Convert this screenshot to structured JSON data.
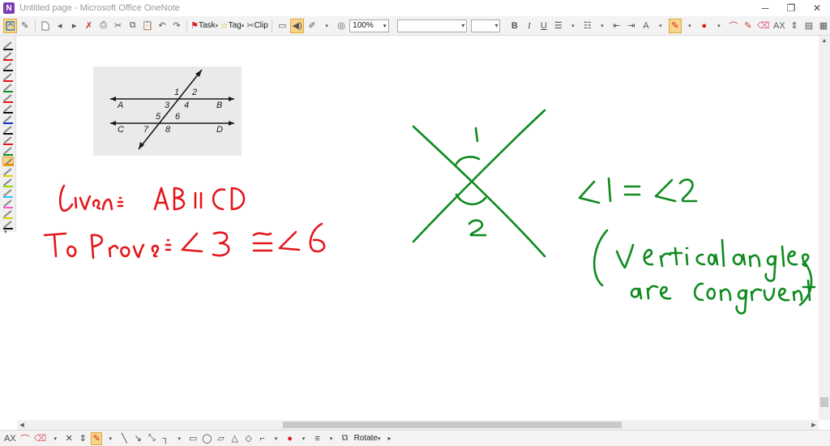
{
  "window": {
    "title": "Untitled page - Microsoft Office OneNote",
    "app_icon": "N",
    "controls": {
      "minimize": "─",
      "restore": "❐",
      "close": "✕"
    }
  },
  "toolbar": {
    "task_label": "Task",
    "tag_label": "Tag",
    "clip_label": "Clip",
    "zoom_value": "100%",
    "font_name": "",
    "font_size": "",
    "bold": "B",
    "italic": "I",
    "underline": "U",
    "ax_label": "AX"
  },
  "drawbar": {
    "ax_label": "AX",
    "rotate_label": "Rotate"
  },
  "figure": {
    "labels": [
      "1",
      "2",
      "3",
      "4",
      "5",
      "6",
      "7",
      "8",
      "A",
      "B",
      "C",
      "D"
    ]
  },
  "colors": {
    "red_ink": "#e3161b",
    "green_ink": "#0e8a1e",
    "accent": "#f7d58a"
  },
  "pens": [
    {
      "color": "#111111"
    },
    {
      "color": "#e3161b"
    },
    {
      "color": "#111111"
    },
    {
      "color": "#e3161b"
    },
    {
      "color": "#0e8a1e"
    },
    {
      "color": "#e3161b"
    },
    {
      "color": "#111111"
    },
    {
      "color": "#1230c8"
    },
    {
      "color": "#111111"
    },
    {
      "color": "#e3161b"
    },
    {
      "color": "#0e8a1e"
    },
    {
      "color": "#e38b0b"
    },
    {
      "color": "#e0d000"
    },
    {
      "color": "#8fd400"
    },
    {
      "color": "#30c0ff"
    },
    {
      "color": "#ff5ac8"
    },
    {
      "color": "#e0d000"
    },
    {
      "color": "#111111"
    }
  ]
}
